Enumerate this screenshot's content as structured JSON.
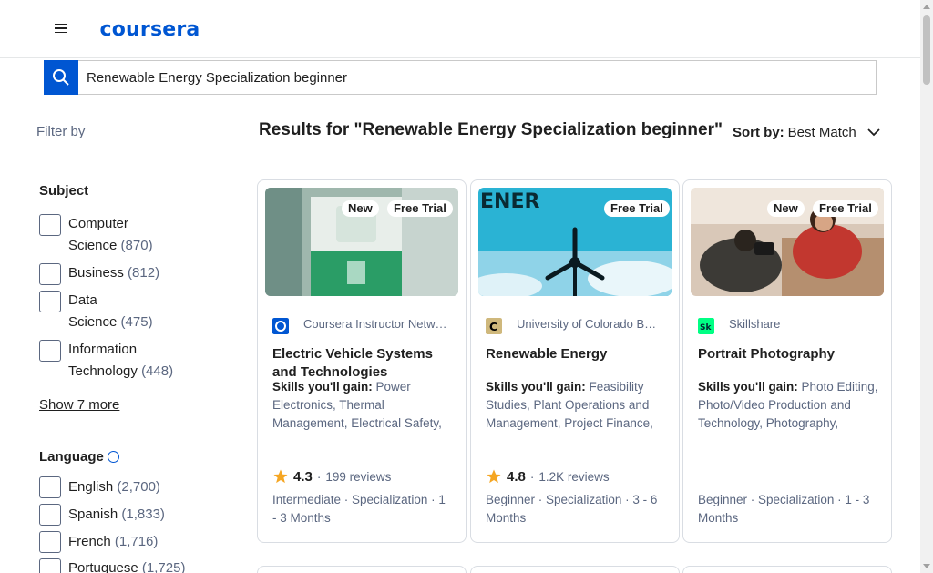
{
  "header": {
    "logo_text": "coursera",
    "menu_icon": "hamburger-icon"
  },
  "search": {
    "value": "Renewable Energy Specialization beginner",
    "icon": "search-icon"
  },
  "sidebar": {
    "filter_by": "Filter by",
    "subject": {
      "title": "Subject",
      "items": [
        {
          "line1": "Computer",
          "line2": "Science",
          "count": "(870)"
        },
        {
          "line1": "Business",
          "line2": "",
          "count": "(812)"
        },
        {
          "line1": "Data",
          "line2": "Science",
          "count": "(475)"
        },
        {
          "line1": "Information",
          "line2": "Technology",
          "count": "(448)"
        }
      ],
      "show_more": "Show 7 more"
    },
    "language": {
      "title": "Language",
      "items": [
        {
          "label": "English",
          "count": "(2,700)"
        },
        {
          "label": "Spanish",
          "count": "(1,833)"
        },
        {
          "label": "French",
          "count": "(1,716)"
        },
        {
          "label": "Portuguese",
          "count": "(1,725)"
        }
      ]
    }
  },
  "results": {
    "title": "Results for \"Renewable Energy Specialization beginner\"",
    "sort_label": "Sort by:",
    "sort_value": "Best Match"
  },
  "cards": [
    {
      "badges": [
        "New",
        "Free Trial"
      ],
      "partner": "Coursera Instructor Network",
      "title": "Electric Vehicle Systems and Technologies",
      "skills_label": "Skills you'll gain:",
      "skills": "Power Electronics, Thermal Management, Electrical Safety, Battery Management",
      "score": "4.3",
      "reviews": "199 reviews",
      "meta": "Intermediate · Specialization · 1 - 3 Months"
    },
    {
      "badges": [
        "Free Trial"
      ],
      "partner": "University of Colorado Boulder",
      "title": "Renewable Energy",
      "skills_label": "Skills you'll gain:",
      "skills": "Feasibility Studies, Plant Operations and Management, Project Finance, Energy",
      "score": "4.8",
      "reviews": "1.2K reviews",
      "meta": "Beginner · Specialization · 3 - 6 Months"
    },
    {
      "badges": [
        "New",
        "Free Trial"
      ],
      "partner": "Skillshare",
      "title": "Portrait Photography",
      "skills_label": "Skills you'll gain:",
      "skills": "Photo Editing, Photo/Video Production and Technology, Photography, Lighting",
      "score": "",
      "reviews": "",
      "meta": "Beginner · Specialization · 1 - 3 Months"
    }
  ],
  "colors": {
    "brand": "#0056d2",
    "star": "#f5a623",
    "muted_text": "#5b6780"
  }
}
